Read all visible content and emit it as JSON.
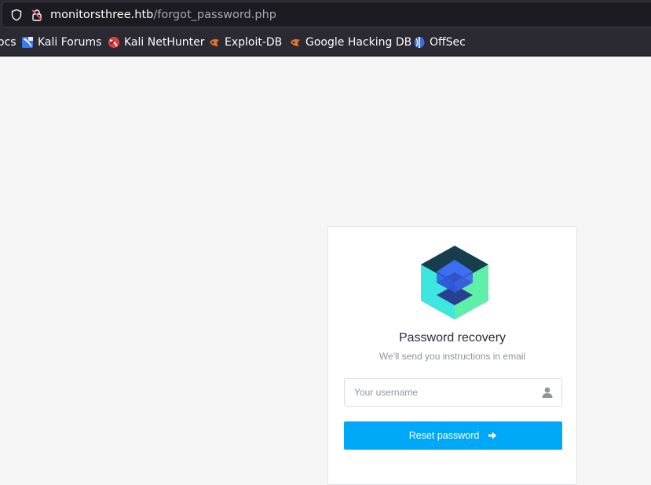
{
  "browser": {
    "url_host": "monitorsthree.htb",
    "url_path": "/forgot_password.php",
    "bookmarks": [
      {
        "label": "ocs",
        "icon": "partial-bookmark"
      },
      {
        "label": "Kali Forums",
        "icon": "kali-forums-icon"
      },
      {
        "label": "Kali NetHunter",
        "icon": "kali-nethunter-icon"
      },
      {
        "label": "Exploit-DB",
        "icon": "exploit-db-icon"
      },
      {
        "label": "Google Hacking DB",
        "icon": "google-hacking-db-icon"
      },
      {
        "label": "OffSec",
        "icon": "offsec-icon"
      }
    ]
  },
  "recovery": {
    "title": "Password recovery",
    "subtitle": "We'll send you instructions in email",
    "username_placeholder": "Your username",
    "username_value": "",
    "submit_label": "Reset password"
  },
  "colors": {
    "accent": "#00a9f7",
    "page_background": "#f5f5f5",
    "browser_chrome": "#2b2a33"
  }
}
